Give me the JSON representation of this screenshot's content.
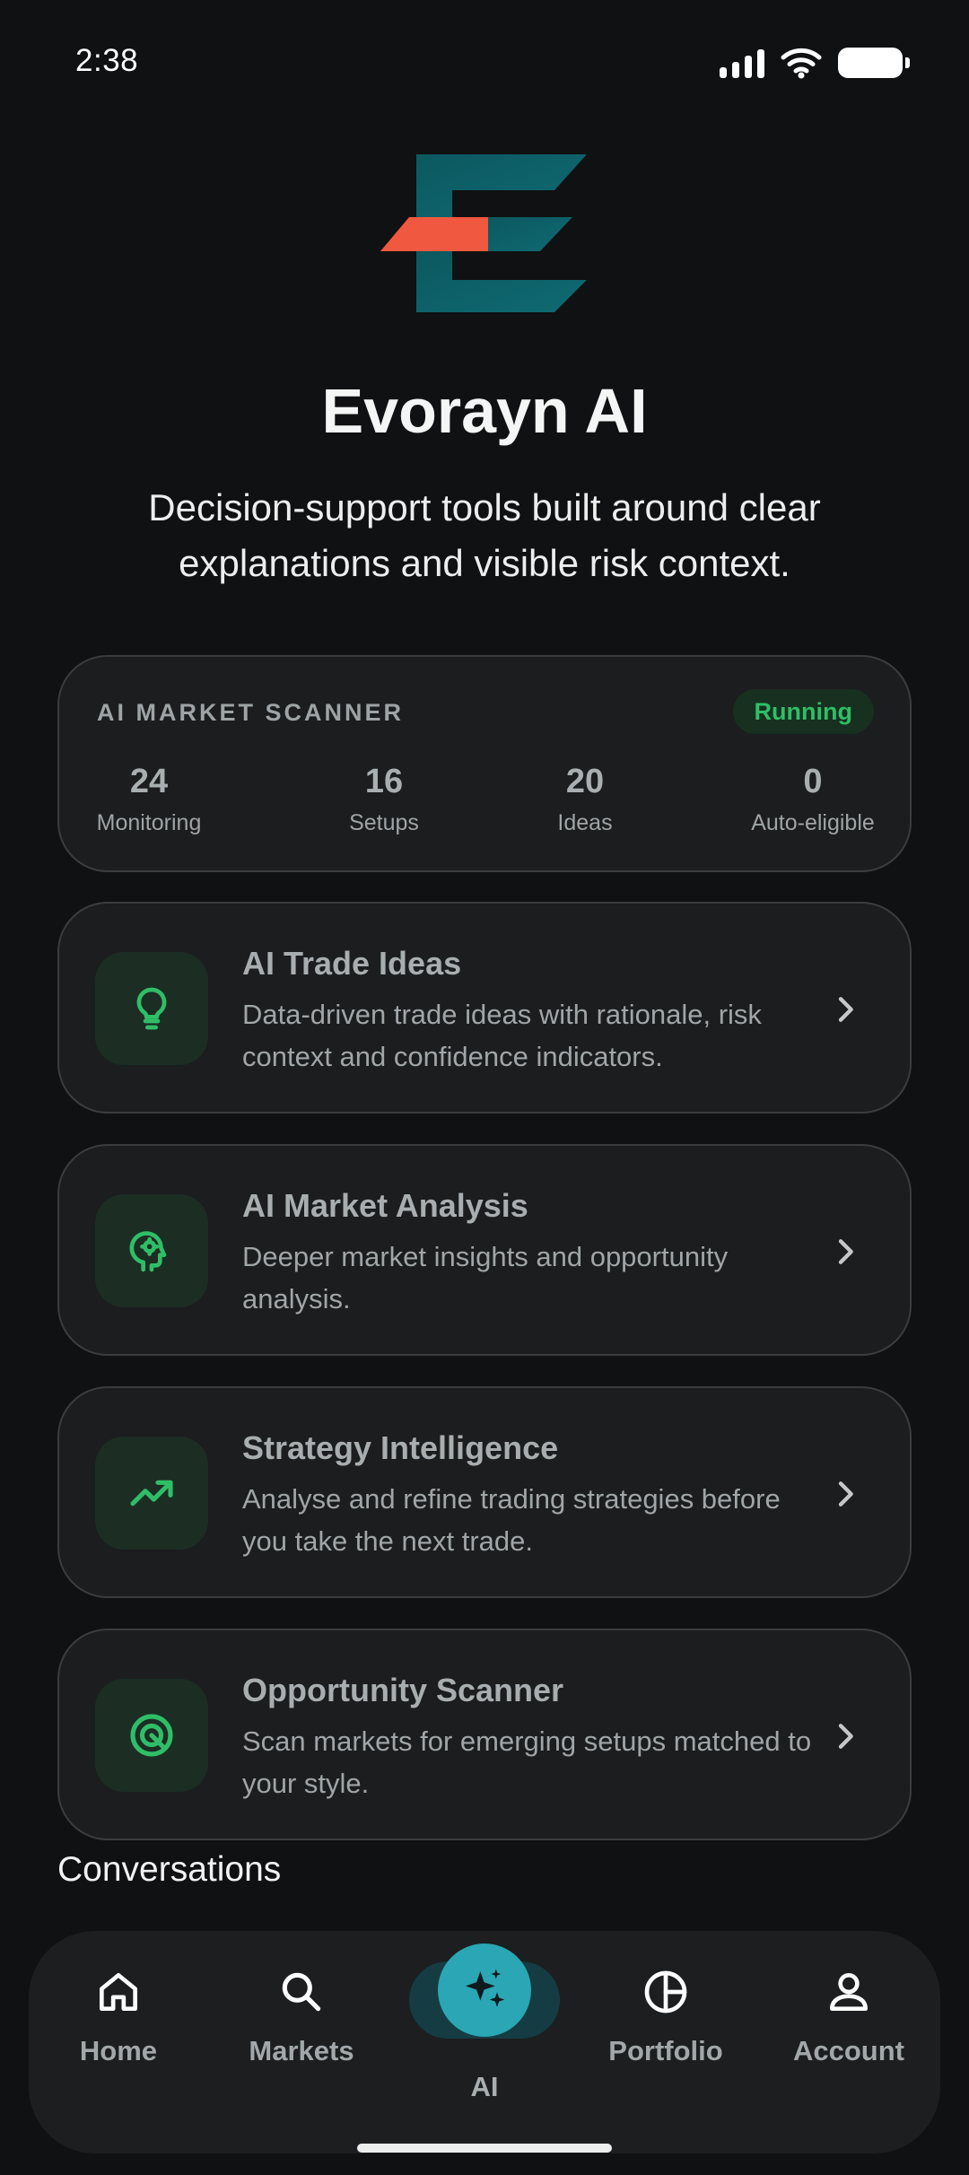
{
  "status_bar": {
    "time": "2:38"
  },
  "header": {
    "title": "Evorayn AI",
    "subtitle": "Decision-support tools built around clear explanations and visible risk context.",
    "logo_colors": {
      "teal": "#0f5b63",
      "accent": "#f0583f"
    }
  },
  "scanner": {
    "label": "AI MARKET SCANNER",
    "status": "Running",
    "stats": [
      {
        "value": "24",
        "label": "Monitoring"
      },
      {
        "value": "16",
        "label": "Setups"
      },
      {
        "value": "20",
        "label": "Ideas"
      },
      {
        "value": "0",
        "label": "Auto-eligible"
      }
    ]
  },
  "features": [
    {
      "icon": "lightbulb-icon",
      "title": "AI Trade Ideas",
      "description": "Data-driven trade ideas with rationale, risk context and confidence indicators."
    },
    {
      "icon": "brain-gear-icon",
      "title": "AI Market Analysis",
      "description": "Deeper market insights and opportunity analysis."
    },
    {
      "icon": "trending-up-icon",
      "title": "Strategy Intelligence",
      "description": "Analyse and refine trading strategies before you take the next trade."
    },
    {
      "icon": "target-icon",
      "title": "Opportunity Scanner",
      "description": "Scan markets for emerging setups matched to your style."
    }
  ],
  "sections": {
    "conversations": "Conversations"
  },
  "nav": {
    "items": [
      {
        "label": "Home",
        "icon": "home-icon"
      },
      {
        "label": "Markets",
        "icon": "search-icon"
      },
      {
        "label": "AI",
        "icon": "sparkle-icon",
        "active": true
      },
      {
        "label": "Portfolio",
        "icon": "pie-chart-icon"
      },
      {
        "label": "Account",
        "icon": "user-icon"
      }
    ]
  },
  "colors": {
    "background": "#101112",
    "card": "#1b1d1f",
    "green_accent": "#2fbe67",
    "ai_accent": "#2aa6b4"
  }
}
